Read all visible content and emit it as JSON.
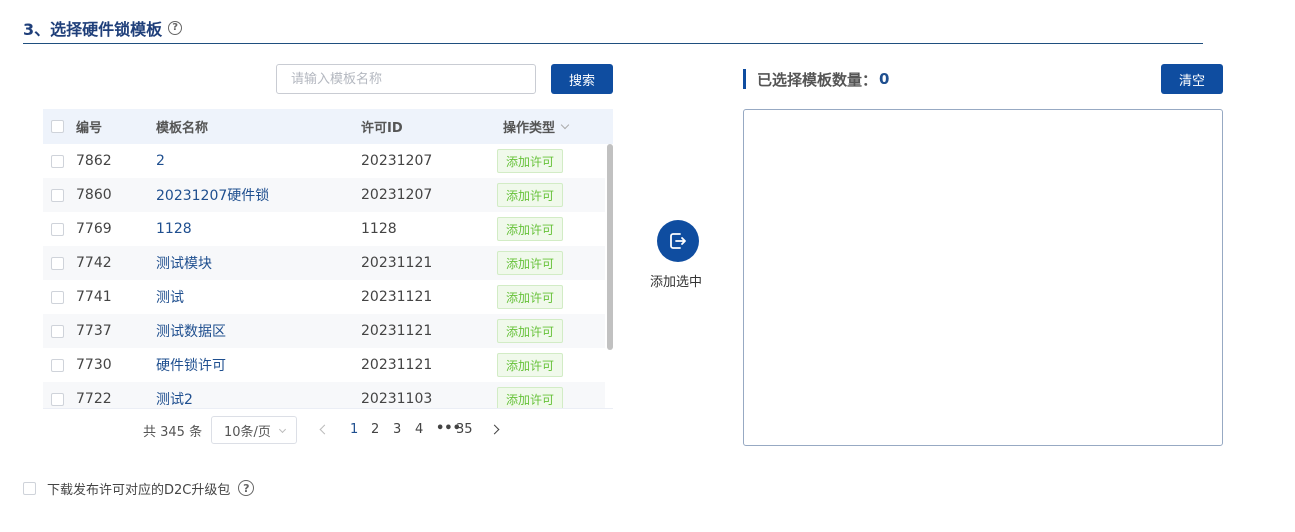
{
  "section": {
    "title": "3、选择硬件锁模板"
  },
  "search": {
    "placeholder": "请输入模板名称",
    "button_label": "搜索"
  },
  "table": {
    "columns": [
      "编号",
      "模板名称",
      "许可ID",
      "操作类型"
    ],
    "rows": [
      {
        "id": "7862",
        "name": "2",
        "license_id": "20231207",
        "type": "添加许可"
      },
      {
        "id": "7860",
        "name": "20231207硬件锁",
        "license_id": "20231207",
        "type": "添加许可"
      },
      {
        "id": "7769",
        "name": "1128",
        "license_id": "1128",
        "type": "添加许可"
      },
      {
        "id": "7742",
        "name": "测试模块",
        "license_id": "20231121",
        "type": "添加许可"
      },
      {
        "id": "7741",
        "name": "测试",
        "license_id": "20231121",
        "type": "添加许可"
      },
      {
        "id": "7737",
        "name": "测试数据区",
        "license_id": "20231121",
        "type": "添加许可"
      },
      {
        "id": "7730",
        "name": "硬件锁许可",
        "license_id": "20231121",
        "type": "添加许可"
      },
      {
        "id": "7722",
        "name": "测试2",
        "license_id": "20231103",
        "type": "添加许可"
      }
    ]
  },
  "pagination": {
    "total_label": "共 345 条",
    "page_size": "10条/页",
    "pages": [
      "1",
      "2",
      "3",
      "4"
    ],
    "current_page": "1",
    "ellipsis": "•••",
    "last_page": "35"
  },
  "transfer": {
    "label": "添加选中",
    "icon": "arrow-right-box-icon"
  },
  "selected": {
    "title": "已选择模板数量：",
    "count": "0",
    "clear_label": "清空"
  },
  "footer": {
    "option_label": "下载发布许可对应的D2C升级包"
  },
  "colors": {
    "primary": "#0f4da0",
    "link": "#1f4f8f",
    "tag_green": "#67c23a",
    "header_bg": "#eef3fb"
  }
}
